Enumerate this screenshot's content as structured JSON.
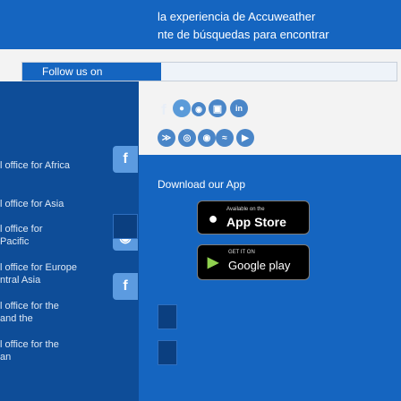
{
  "banner": {
    "line1": "la experiencia de Accuweather",
    "line2": "nte de búsquedas para encontrar"
  },
  "follow": {
    "label": "Follow us on"
  },
  "left_items": [
    "l office for Africa",
    "l office for Asia",
    "l office for",
    "Pacific",
    "l office for Europe",
    "ntral Asia",
    "l office for the",
    "and the",
    "l office for the",
    "an"
  ],
  "social_icons": [
    "facebook-icon",
    "flickr-icon",
    "rss-icon",
    "instagram-icon",
    "linkedin-icon",
    "rss-feed-icon",
    "slideshare-icon",
    "github-icon",
    "spotify-icon",
    "youtube-icon"
  ],
  "download": {
    "label": "Download our App",
    "app_store_small": "Available on the",
    "app_store_big": "App Store",
    "google_small": "GET IT ON",
    "google_big": "Google play"
  },
  "colors": {
    "brand_blue": "#1565c0",
    "dark_blue": "#0e4d98",
    "light_bg": "#f3f3f3"
  }
}
